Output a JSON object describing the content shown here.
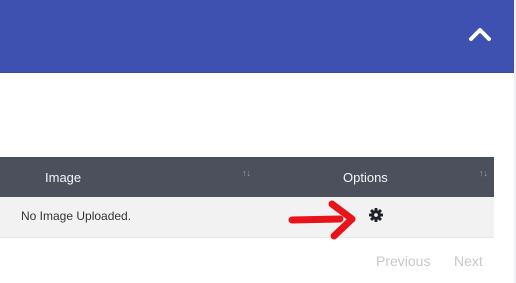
{
  "table": {
    "columns": [
      {
        "label": "Image",
        "sort_icon": "sort-updown-icon"
      },
      {
        "label": "Options",
        "sort_icon": "sort-updown-icon"
      }
    ],
    "rows": [
      {
        "image": "No Image Uploaded.",
        "options_icon": "gear-icon"
      }
    ],
    "sort_glyph": "↑↓"
  },
  "pagination": {
    "previous": "Previous",
    "next": "Next"
  },
  "colors": {
    "header": "#3f51b0",
    "table_header": "#4b505c",
    "row": "#f2f2f2",
    "annotation_arrow": "#e8141a"
  },
  "icons": {
    "collapse": "chevron-up-icon",
    "annotation": "red-arrow-pointer"
  }
}
